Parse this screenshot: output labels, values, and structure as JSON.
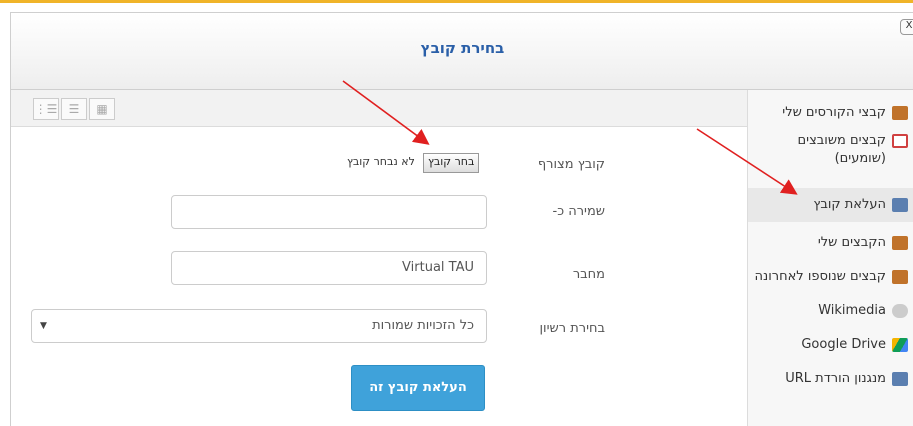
{
  "dialog": {
    "title": "בחירת קובץ",
    "close_label": "X"
  },
  "sidebar": {
    "items": [
      {
        "label": "קבצי הקורסים שלי",
        "icon": "course-files-icon",
        "color": "#c0722a"
      },
      {
        "label": "קבצים משובצים (שומעים)",
        "icon": "embedded-files-icon",
        "color": "#d04040"
      },
      {
        "label": "העלאת קובץ",
        "icon": "upload-icon",
        "color": "#5b7fb0"
      },
      {
        "label": "הקבצים שלי",
        "icon": "my-files-icon",
        "color": "#c0722a"
      },
      {
        "label": "קבצים שנוספו לאחרונה",
        "icon": "recent-files-icon",
        "color": "#c0722a"
      },
      {
        "label": "Wikimedia",
        "icon": "wikimedia-icon",
        "color": "#999999"
      },
      {
        "label": "Google Drive",
        "icon": "google-drive-icon",
        "color": "#f4b400"
      },
      {
        "label": "מנגנון הורדת URL",
        "icon": "url-download-icon",
        "color": "#5b7fb0"
      }
    ]
  },
  "toolbar": {
    "view_icons": [
      "grid-view-icon",
      "list-view-icon",
      "tree-view-icon"
    ]
  },
  "form": {
    "attachment_label": "קובץ מצורף",
    "choose_file_button": "בחר קובץ",
    "no_file_text": "לא נבחר קובץ",
    "save_as_label": "שמירה כ-",
    "save_as_value": "",
    "author_label": "מחבר",
    "author_value": "Virtual TAU",
    "license_label": "בחירת רשיון",
    "license_value": "כל הזכויות שמורות",
    "upload_button": "העלאת קובץ זה"
  },
  "colors": {
    "accent": "#3fa2da",
    "title": "#2a5fa8",
    "annotation_arrow": "#e02020",
    "top_border": "#f0b429"
  }
}
